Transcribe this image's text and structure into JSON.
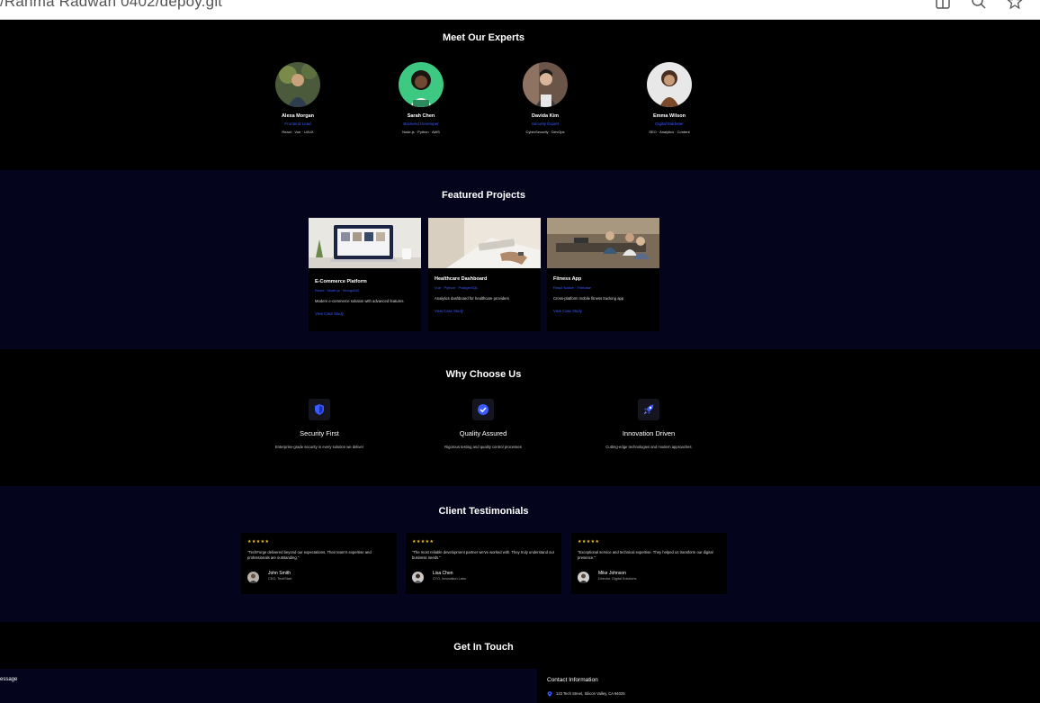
{
  "browser": {
    "url": "/Rahma Radwan 0402/depoy.git"
  },
  "experts": {
    "title": "Meet Our Experts",
    "people": [
      {
        "name": "Alexa Morgan",
        "role": "Frontend Lead",
        "skills": "React · Vue · UI/UX"
      },
      {
        "name": "Sarah Chen",
        "role": "Backend Developer",
        "skills": "Node.js · Python · AWS"
      },
      {
        "name": "Davida Kim",
        "role": "Security Expert",
        "skills": "CyberSecurity · DevOps"
      },
      {
        "name": "Emma Wilson",
        "role": "Digital Marketer",
        "skills": "SEO · Analytics · Content"
      }
    ]
  },
  "projects": {
    "title": "Featured Projects",
    "items": [
      {
        "title": "E-Commerce Platform",
        "tags": "React · Node.js · MongoDB",
        "desc": "Modern e-commerce solution with advanced features",
        "link": "View Case Study"
      },
      {
        "title": "Healthcare Dashboard",
        "tags": "Vue · Python · PostgreSQL",
        "desc": "Analytics dashboard for healthcare providers",
        "link": "View Case Study"
      },
      {
        "title": "Fitness App",
        "tags": "React Native · Firebase",
        "desc": "Cross-platform mobile fitness tracking app",
        "link": "View Case Study"
      }
    ]
  },
  "why": {
    "title": "Why Choose Us",
    "features": [
      {
        "icon": "shield-icon",
        "title": "Security First",
        "desc": "Enterprise-grade security in every solution we deliver"
      },
      {
        "icon": "check-circle-icon",
        "title": "Quality Assured",
        "desc": "Rigorous testing and quality control processes"
      },
      {
        "icon": "rocket-icon",
        "title": "Innovation Driven",
        "desc": "Cutting-edge technologies and modern approaches"
      }
    ]
  },
  "testimonials": {
    "title": "Client Testimonials",
    "stars": "★★★★★",
    "items": [
      {
        "quote": "\"TechForge delivered beyond our expectations. Their team's expertise and professionals are outstanding.\"",
        "name": "John Smith",
        "role": "CEO, TechStart"
      },
      {
        "quote": "\"The most reliable development partner we've worked with. They truly understand our business needs.\"",
        "name": "Lisa Chen",
        "role": "CTO, Innovation Labs"
      },
      {
        "quote": "\"Exceptional service and technical expertise. They helped us transform our digital presence.\"",
        "name": "Mike Johnson",
        "role": "Director, Digital Solutions"
      }
    ]
  },
  "contact": {
    "title": "Get In Touch",
    "message_label": "essage",
    "info_title": "Contact Information",
    "address": "123 Tech Street, Silicon Valley, CA 94025"
  },
  "colors": {
    "accent": "#3a5bff",
    "section_dark": "#000000",
    "section_navy": "#04041c",
    "star": "#f2c230"
  }
}
